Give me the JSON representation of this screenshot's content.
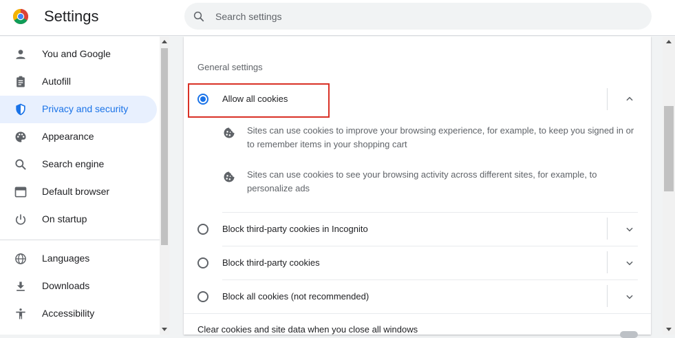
{
  "header": {
    "title": "Settings",
    "search_placeholder": "Search settings",
    "logo_icon": "chrome-logo-icon"
  },
  "sidebar": {
    "items": [
      {
        "label": "You and Google",
        "icon": "person-icon"
      },
      {
        "label": "Autofill",
        "icon": "clipboard-icon"
      },
      {
        "label": "Privacy and security",
        "icon": "shield-icon",
        "active": true
      },
      {
        "label": "Appearance",
        "icon": "palette-icon"
      },
      {
        "label": "Search engine",
        "icon": "search-icon"
      },
      {
        "label": "Default browser",
        "icon": "browser-window-icon"
      },
      {
        "label": "On startup",
        "icon": "power-icon"
      },
      {
        "label": "Languages",
        "icon": "globe-icon"
      },
      {
        "label": "Downloads",
        "icon": "download-icon"
      },
      {
        "label": "Accessibility",
        "icon": "accessibility-icon"
      }
    ]
  },
  "main": {
    "section_title": "General settings",
    "options": [
      {
        "label": "Allow all cookies",
        "checked": true,
        "expanded": true
      },
      {
        "label": "Block third-party cookies in Incognito",
        "checked": false
      },
      {
        "label": "Block third-party cookies",
        "checked": false
      },
      {
        "label": "Block all cookies (not recommended)",
        "checked": false
      }
    ],
    "details": [
      "Sites can use cookies to improve your browsing experience, for example, to keep you signed in or to remember items in your shopping cart",
      "Sites can use cookies to see your browsing activity across different sites, for example, to personalize ads"
    ],
    "clear_on_exit_label": "Clear cookies and site data when you close all windows"
  },
  "colors": {
    "accent": "#1a73e8",
    "active_bg": "#e8f0fe",
    "highlight_border": "#d93025"
  }
}
